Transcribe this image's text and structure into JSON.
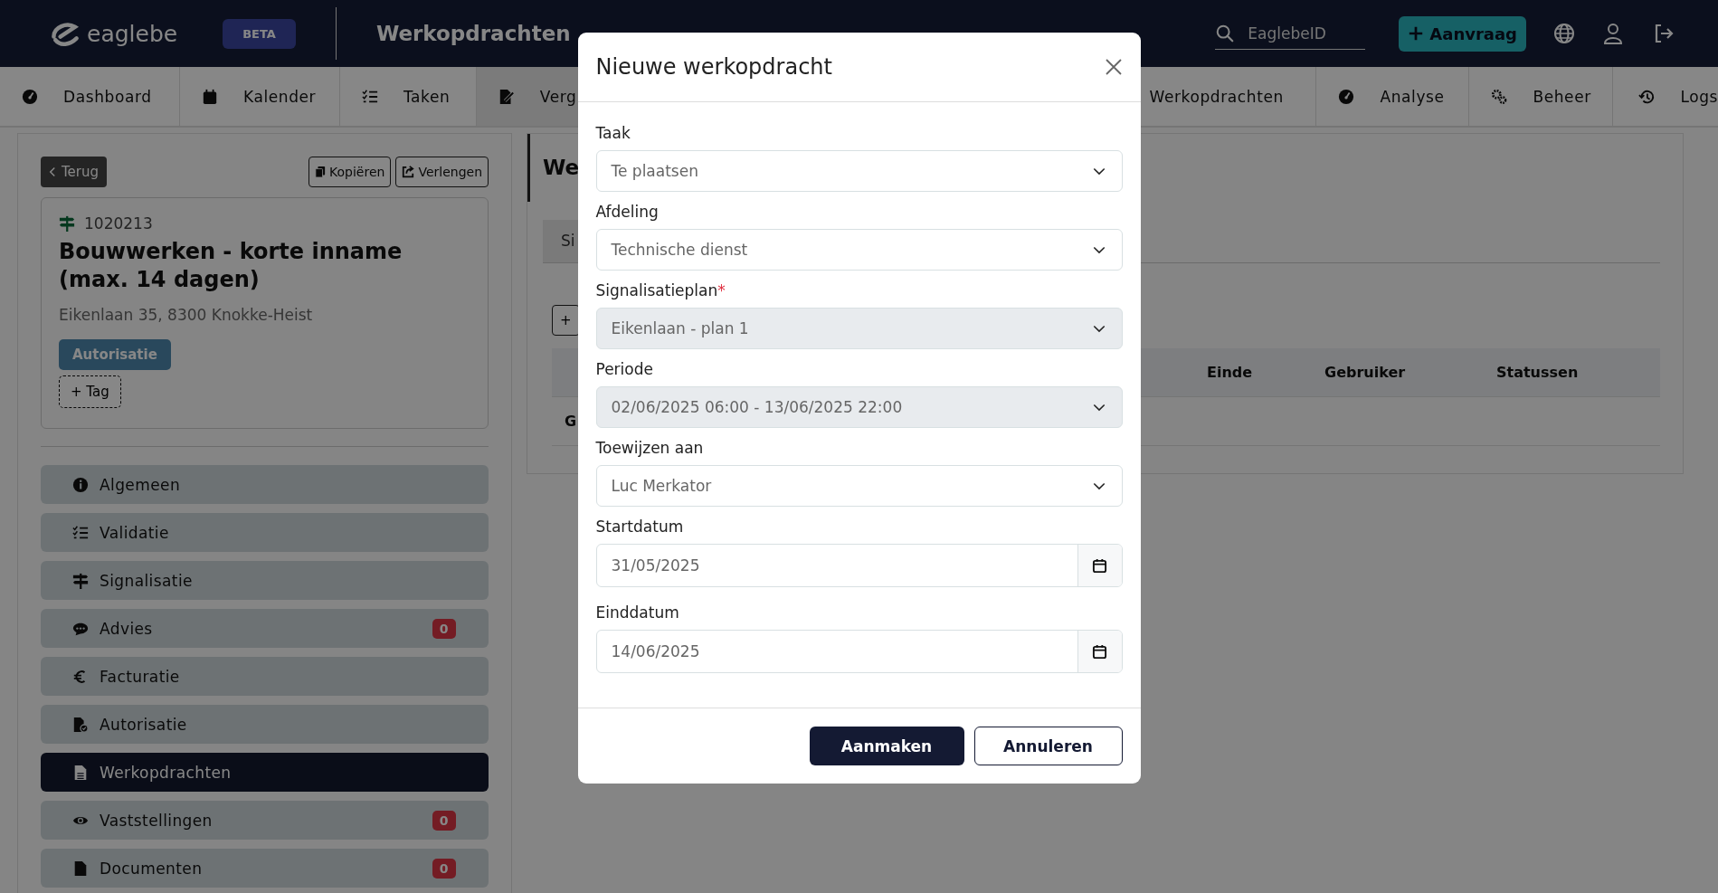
{
  "header": {
    "logo": "eaglebe",
    "badge": "BETA",
    "title": "Werkopdrachten",
    "search": {
      "placeholder": "EaglebeID"
    },
    "request_button": "Aanvraag"
  },
  "nav": [
    {
      "label": "Dashboard",
      "selected": false
    },
    {
      "label": "Kalender",
      "selected": false
    },
    {
      "label": "Taken",
      "selected": false
    },
    {
      "label": "Verg",
      "selected": true
    },
    {
      "label": "Werkopdrachten",
      "selected": false
    },
    {
      "label": "Analyse",
      "selected": false
    },
    {
      "label": "Beheer",
      "selected": false
    },
    {
      "label": "Logs",
      "selected": false
    }
  ],
  "sidebar": {
    "back_button": "Terug",
    "actions": [
      "Kopiëren",
      "Verlengen"
    ],
    "card": {
      "id": "1020213",
      "title": "Bouwwerken - korte inname (max. 14 dagen)",
      "address": "Eikenlaan 35, 8300 Knokke-Heist",
      "tags": [
        "Autorisatie"
      ],
      "add_tag": "+ Tag"
    },
    "menu": [
      {
        "label": "Algemeen",
        "selected": false
      },
      {
        "label": "Validatie",
        "selected": false
      },
      {
        "label": "Signalisatie",
        "selected": false
      },
      {
        "label": "Advies",
        "badge": "0",
        "selected": false
      },
      {
        "label": "Facturatie",
        "selected": false
      },
      {
        "label": "Autorisatie",
        "selected": false
      },
      {
        "label": "Werkopdrachten",
        "selected": true
      },
      {
        "label": "Vaststellingen",
        "badge": "0",
        "selected": false
      },
      {
        "label": "Documenten",
        "badge": "0",
        "selected": false
      }
    ]
  },
  "main": {
    "heading": "We",
    "tabs": [
      {
        "label": "Si"
      }
    ],
    "add_button": "+",
    "table": {
      "columns": [
        "Einde",
        "Gebruiker",
        "Statussen"
      ],
      "rows": [
        [
          "G"
        ]
      ]
    }
  },
  "dialog": {
    "title": "Nieuwe werkopdracht",
    "fields": [
      {
        "label": "Taak",
        "kind": "select",
        "value": "Te plaatsen",
        "disabled": false
      },
      {
        "label": "Afdeling",
        "kind": "select",
        "value": "Technische dienst",
        "disabled": false
      },
      {
        "label": "Signalisatieplan",
        "required_mark": "*",
        "kind": "select",
        "value": "Eikenlaan - plan 1",
        "disabled": true
      },
      {
        "label": "Periode",
        "kind": "select",
        "value": "02/06/2025 06:00 - 13/06/2025 22:00",
        "disabled": true
      },
      {
        "label": "Toewijzen aan",
        "kind": "select",
        "value": "Luc Merkator",
        "disabled": false
      },
      {
        "label": "Startdatum",
        "kind": "date",
        "value": "31/05/2025",
        "disabled": false
      },
      {
        "label": "Einddatum",
        "kind": "date",
        "value": "14/06/2025",
        "disabled": false
      }
    ],
    "buttons": [
      {
        "label": "Aanmaken",
        "kind": "primary"
      },
      {
        "label": "Annuleren",
        "kind": "secondary"
      }
    ]
  }
}
